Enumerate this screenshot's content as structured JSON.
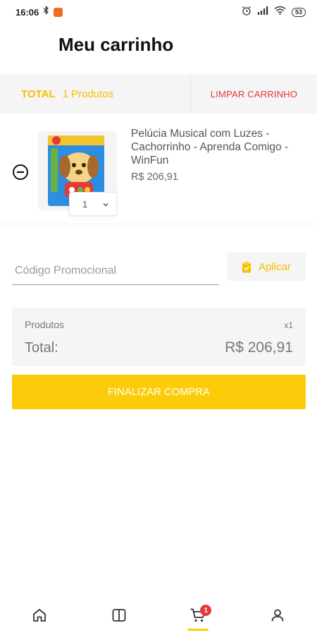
{
  "status_bar": {
    "time": "16:06",
    "battery": "53"
  },
  "header": {
    "title": "Meu carrinho"
  },
  "total_bar": {
    "label": "TOTAL",
    "count": "1 Produtos",
    "clear_label": "LIMPAR CARRINHO"
  },
  "cart": {
    "items": [
      {
        "name": "Pelúcia Musical com Luzes - Cachorrinho - Aprenda Comigo - WinFun",
        "price": "R$ 206,91",
        "quantity": "1"
      }
    ]
  },
  "promo": {
    "placeholder": "Código Promocional",
    "apply_label": "Aplicar"
  },
  "summary": {
    "products_label": "Produtos",
    "products_qty": "x1",
    "total_label": "Total:",
    "total_value": "R$ 206,91"
  },
  "checkout": {
    "label": "FINALIZAR COMPRA"
  },
  "bottom_nav": {
    "items": [
      {
        "icon": "home-icon"
      },
      {
        "icon": "catalog-icon"
      },
      {
        "icon": "cart-icon",
        "badge": "1",
        "active": true
      },
      {
        "icon": "profile-icon"
      }
    ]
  },
  "colors": {
    "accent": "#fccc0a",
    "accent_text": "#f5c000",
    "danger": "#e03a3a",
    "badge": "#e53935"
  }
}
